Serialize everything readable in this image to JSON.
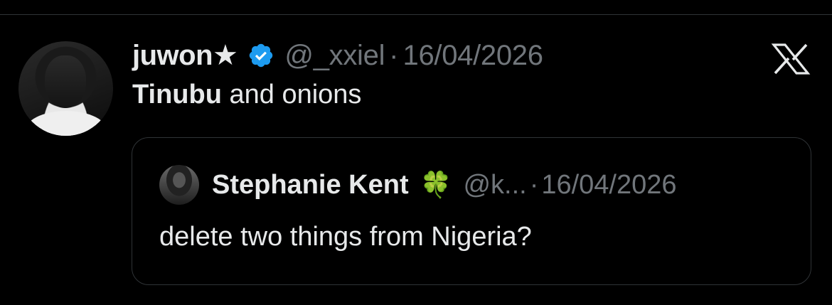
{
  "tweet": {
    "author_name": "juwon★",
    "handle": "@_xxiel",
    "separator": "·",
    "date": "16/04/2026",
    "text_bold": "Tinubu",
    "text_rest": " and onions",
    "verified": true,
    "avatar_icon": "user-avatar",
    "brand_icon": "x-logo-icon"
  },
  "quote": {
    "author_name": "Stephanie Kent",
    "emoji": "🍀",
    "handle": "@k...",
    "separator": "·",
    "date": "16/04/2026",
    "text": "delete two things from Nigeria?"
  },
  "colors": {
    "background": "#000000",
    "text": "#e7e9ea",
    "muted": "#71767b",
    "border": "#2f3336",
    "verified": "#1d9bf0"
  }
}
